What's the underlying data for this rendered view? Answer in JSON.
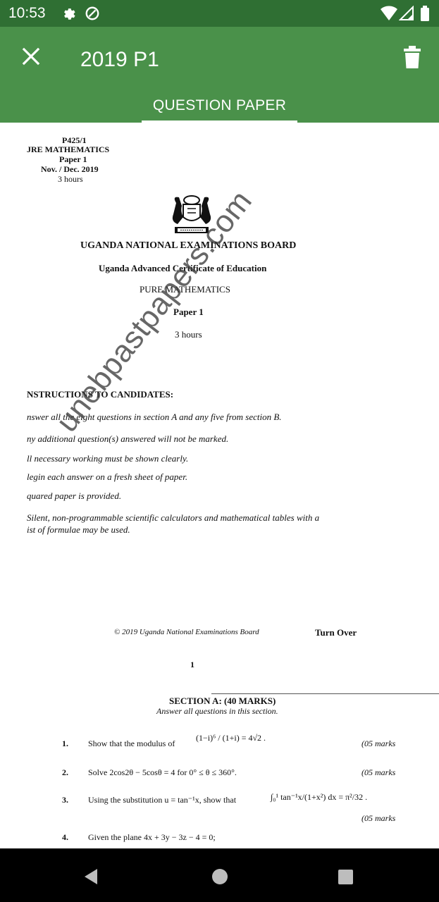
{
  "status_bar": {
    "time": "10:53",
    "icons": [
      "gear-icon",
      "data-saver-icon",
      "wifi-icon",
      "signal-icon",
      "battery-icon"
    ]
  },
  "app_bar": {
    "title": "2019 P1",
    "tab_label": "QUESTION PAPER",
    "color": "#4a914a",
    "status_color": "#2f6f33"
  },
  "document": {
    "header": {
      "code": "P425/1",
      "subject": "JRE MATHEMATICS",
      "paper": "Paper 1",
      "session": "Nov. / Dec. 2019",
      "duration": "3 hours"
    },
    "board": "UGANDA NATIONAL EXAMINATIONS BOARD",
    "certificate": "Uganda Advanced Certificate of Education",
    "subject_title": "PURE MATHEMATICS",
    "paper_title": "Paper 1",
    "paper_duration": "3 hours",
    "watermark": "unebpastpapers.com",
    "instructions_heading": "NSTRUCTIONS TO CANDIDATES:",
    "instructions": [
      "nswer all the eight questions in section A and any five from section B.",
      "ny additional question(s) answered will not be marked.",
      "ll necessary working must be shown clearly.",
      "legin each answer on a fresh sheet of paper.",
      "quared paper is provided.",
      "Silent, non-programmable scientific calculators and mathematical tables with a",
      "ist of formulae may be used."
    ],
    "copyright": "© 2019 Uganda National Examinations Board",
    "turn_over": "Turn Over",
    "page_number": "1",
    "section_heading": "SECTION A: (40 MARKS)",
    "section_note": "Answer all questions in this section.",
    "questions": [
      {
        "number": "1.",
        "text": "Show that the modulus of",
        "math": "(1−i)⁶ / (1+i) = 4√2 .",
        "marks": "(05 marks"
      },
      {
        "number": "2.",
        "text": "Solve  2cos2θ − 5cosθ = 4  for  0° ≤ θ ≤ 360°.",
        "marks": "(05 marks"
      },
      {
        "number": "3.",
        "text": "Using the substitution  u = tan⁻¹x,  show that",
        "math": "∫₀¹ tan⁻¹x/(1+x²) dx = π²/32 .",
        "marks": "(05 marks"
      },
      {
        "number": "4.",
        "text": "Given the plane  4x + 3y − 3z − 4 = 0;"
      }
    ]
  },
  "nav_bar": {
    "buttons": [
      "back-icon",
      "home-icon",
      "recents-icon"
    ]
  }
}
